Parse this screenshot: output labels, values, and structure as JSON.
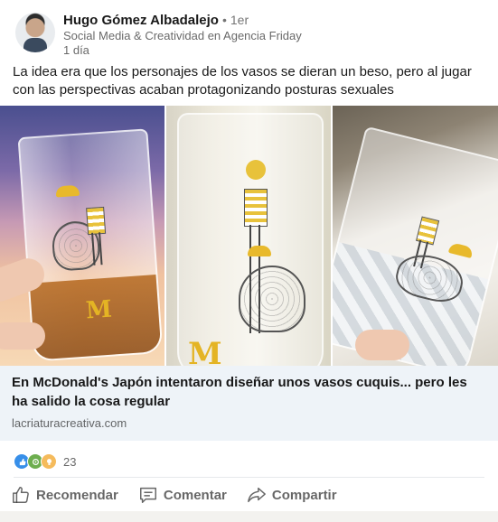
{
  "post": {
    "author": {
      "name": "Hugo Gómez Albadalejo",
      "separator": "•",
      "degree": "1er",
      "headline": "Social Media & Creatividad en Agencia Friday",
      "time": "1 día"
    },
    "text": "La idea era que los personajes de los vasos se dieran un beso, pero al jugar con las perspectivas acaban protagonizando posturas sexuales",
    "images": [
      {
        "icon": "photo-cup-sunset"
      },
      {
        "icon": "photo-cup-closeup"
      },
      {
        "icon": "photo-cup-ice"
      }
    ],
    "link": {
      "title": "En McDonald's Japón intentaron diseñar unos vasos cuquis... pero les ha salido la cosa regular",
      "domain": "lacriaturacreativa.com"
    },
    "reactions": {
      "icons": [
        "like-icon",
        "celebrate-icon",
        "insightful-icon"
      ],
      "count": "23"
    },
    "actions": {
      "like": "Recomendar",
      "comment": "Comentar",
      "share": "Compartir"
    }
  },
  "colors": {
    "link_bg": "#eef3f8",
    "like": "#378fe9",
    "celebrate": "#6dae4f",
    "insight": "#f5bb5c",
    "mcd_yellow": "#e4b424"
  }
}
